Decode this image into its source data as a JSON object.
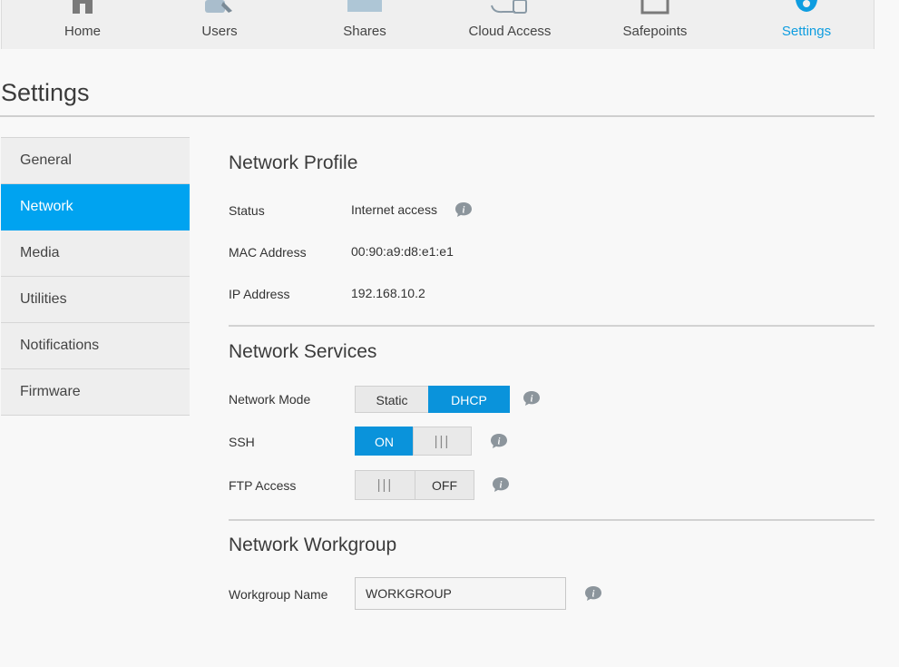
{
  "nav": {
    "items": [
      {
        "label": "Home",
        "icon": "home-icon"
      },
      {
        "label": "Users",
        "icon": "users-icon"
      },
      {
        "label": "Shares",
        "icon": "shares-icon"
      },
      {
        "label": "Cloud Access",
        "icon": "cloud-access-icon"
      },
      {
        "label": "Safepoints",
        "icon": "safepoints-icon"
      },
      {
        "label": "Settings",
        "icon": "settings-gear-icon"
      }
    ],
    "active": "Settings",
    "active_color": "#0e9de0"
  },
  "page": {
    "title": "Settings"
  },
  "sidebar": {
    "items": [
      {
        "label": "General"
      },
      {
        "label": "Network"
      },
      {
        "label": "Media"
      },
      {
        "label": "Utilities"
      },
      {
        "label": "Notifications"
      },
      {
        "label": "Firmware"
      }
    ],
    "active": "Network",
    "active_color": "#00a3f0"
  },
  "profile": {
    "title": "Network Profile",
    "status_label": "Status",
    "status_value": "Internet access",
    "mac_label": "MAC Address",
    "mac_value": "00:90:a9:d8:e1:e1",
    "ip_label": "IP Address",
    "ip_value": "192.168.10.2"
  },
  "services": {
    "title": "Network Services",
    "mode_label": "Network Mode",
    "mode_options": [
      "Static",
      "DHCP"
    ],
    "mode_selected": "DHCP",
    "ssh_label": "SSH",
    "ssh_on_label": "ON",
    "ssh_state": "on",
    "ftp_label": "FTP Access",
    "ftp_off_label": "OFF",
    "ftp_state": "off",
    "grip": "|||"
  },
  "workgroup": {
    "title": "Network Workgroup",
    "name_label": "Workgroup Name",
    "name_value": "WORKGROUP"
  }
}
